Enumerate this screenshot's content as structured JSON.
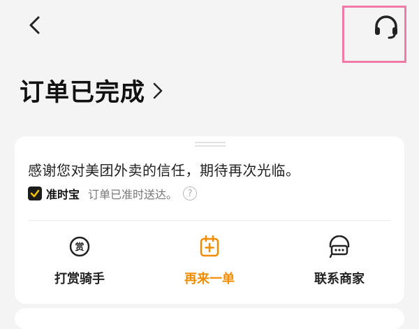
{
  "header": {
    "back_icon": "chevron-left-icon",
    "customer_service_icon": "headset-icon",
    "highlight_color": "#f27aa6"
  },
  "order": {
    "title": "订单已完成",
    "thanks_text": "感谢您对美团外卖的信任，期待再次光临。",
    "ontime_label": "准时宝",
    "ontime_text": "订单已准时送达。",
    "help_icon": "question-circle-icon"
  },
  "actions": [
    {
      "label": "打赏骑手",
      "icon": "reward-icon"
    },
    {
      "label": "再来一单",
      "icon": "reorder-icon",
      "color": "#f28c00"
    },
    {
      "label": "联系商家",
      "icon": "merchant-chat-icon"
    }
  ],
  "colors": {
    "accent": "#f28c00",
    "background": "#f4f4f4",
    "card": "#ffffff"
  }
}
